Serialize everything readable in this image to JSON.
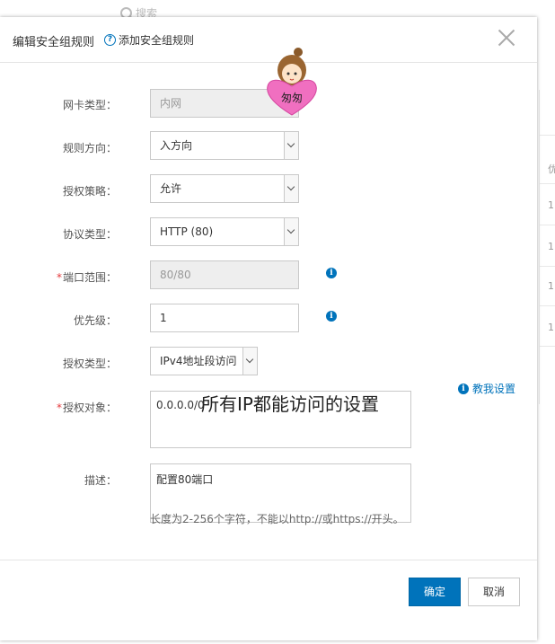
{
  "background": {
    "search_placeholder": "搜索",
    "table_header": "优",
    "row_values": [
      "1",
      "1",
      "1",
      "1"
    ]
  },
  "dialog": {
    "title": "编辑安全组规则",
    "help_link": "添加安全组规则",
    "close_label": "×"
  },
  "form": {
    "nic_type": {
      "label": "网卡类型：",
      "value": "内网"
    },
    "direction": {
      "label": "规则方向：",
      "value": "入方向"
    },
    "policy": {
      "label": "授权策略：",
      "value": "允许"
    },
    "protocol": {
      "label": "协议类型：",
      "value": "HTTP (80)"
    },
    "port_range": {
      "label": "端口范围：",
      "value": "80/80",
      "required": "*"
    },
    "priority": {
      "label": "优先级：",
      "value": "1"
    },
    "auth_type": {
      "label": "授权类型：",
      "value": "IPv4地址段访问"
    },
    "auth_object": {
      "label": "授权对象：",
      "value": "0.0.0.0/0",
      "required": "*"
    },
    "tutorial_link": "教我设置",
    "description": {
      "label": "描述：",
      "value": "配置80端口"
    },
    "hint": "长度为2-256个字符，不能以http://或https://开头。"
  },
  "overlay_annotation": "所有IP都能访问的设置",
  "sticker_text": "匆匆",
  "footer": {
    "confirm_label": "确定",
    "cancel_label": "取消"
  },
  "colors": {
    "primary": "#0073bb",
    "required": "#e4393c",
    "sticker_heart": "#f06fc0"
  }
}
